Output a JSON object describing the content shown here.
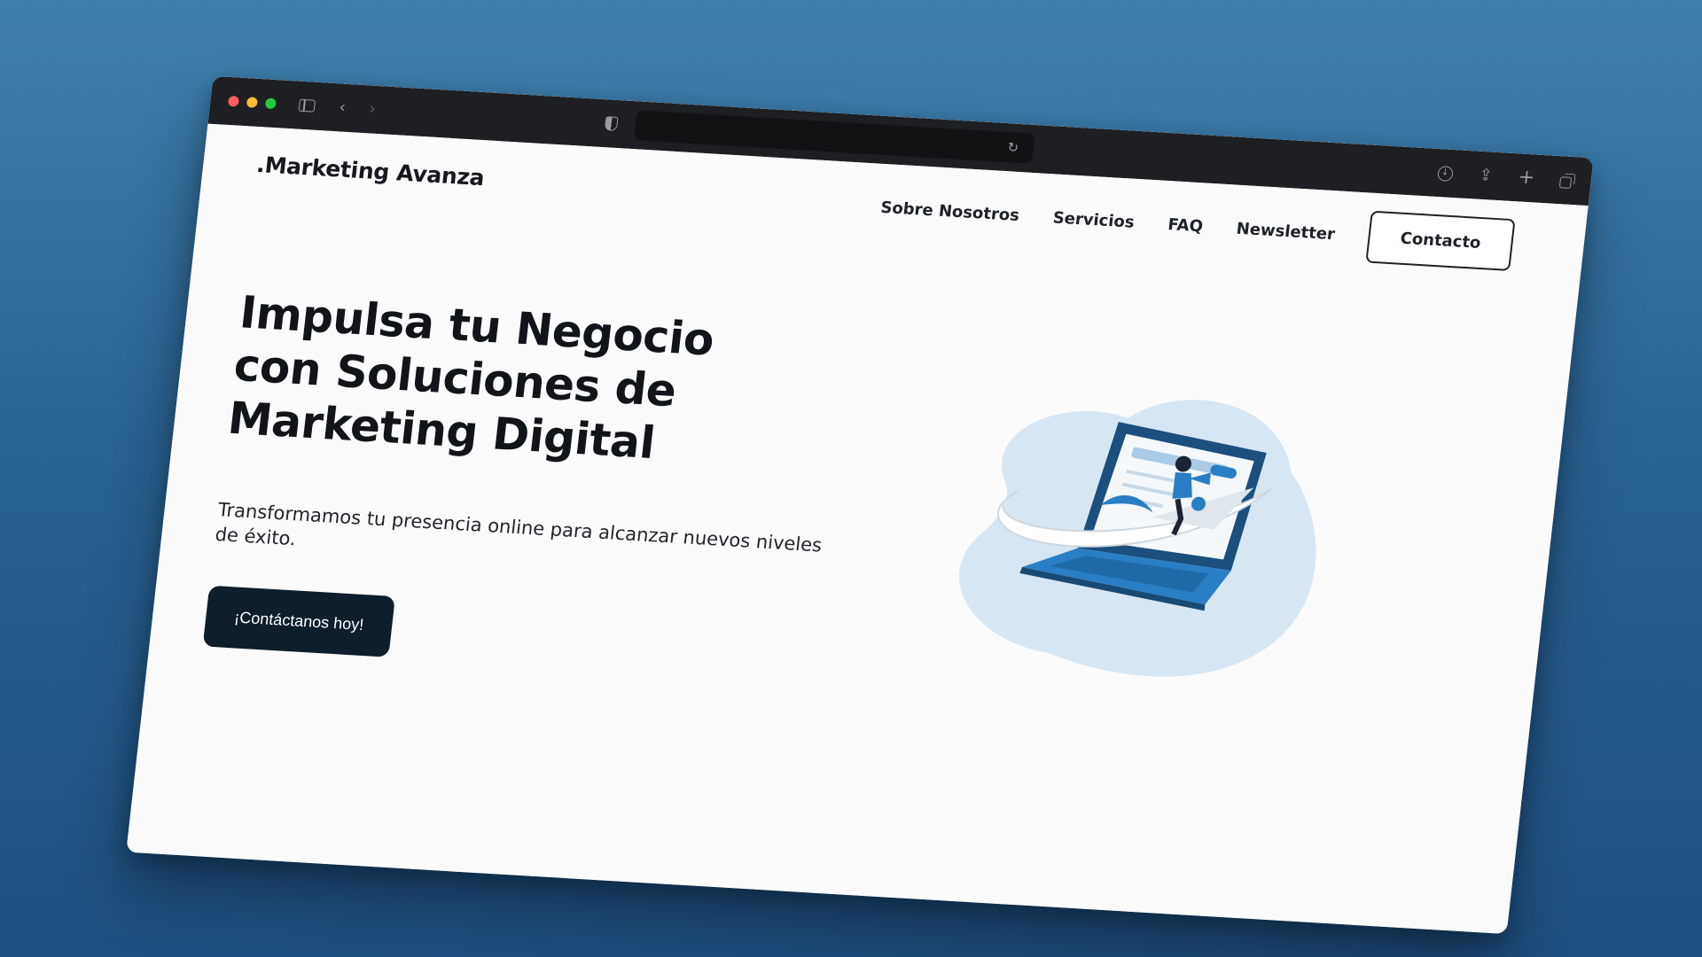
{
  "browser": {
    "toolbar_icons": [
      "close-light",
      "minimize-light",
      "zoom-light",
      "sidebar-icon",
      "back-arrow-icon",
      "forward-arrow-icon",
      "shield-icon",
      "reload-icon",
      "download-icon",
      "share-icon",
      "new-tab-icon",
      "tabs-overview-icon"
    ],
    "address_value": ""
  },
  "site": {
    "logo": ".Marketing Avanza",
    "nav": {
      "items": [
        "Sobre Nosotros",
        "Servicios",
        "FAQ",
        "Newsletter"
      ],
      "contact_button": "Contacto"
    },
    "hero": {
      "headline": "Impulsa tu Negocio con Soluciones de Marketing Digital",
      "subtitle": "Transformamos tu presencia online para alcanzar nuevos niveles de éxito.",
      "cta_label": "¡Contáctanos hoy!"
    }
  },
  "colors": {
    "background_top": "#3f7fac",
    "background_bottom": "#1d4f80",
    "toolbar": "#1e1f22",
    "page": "#fbfbfb",
    "cta_bg": "#0e1e2b",
    "illustration_blue": "#2a7fc4",
    "illustration_blob": "#d6e6f3"
  }
}
